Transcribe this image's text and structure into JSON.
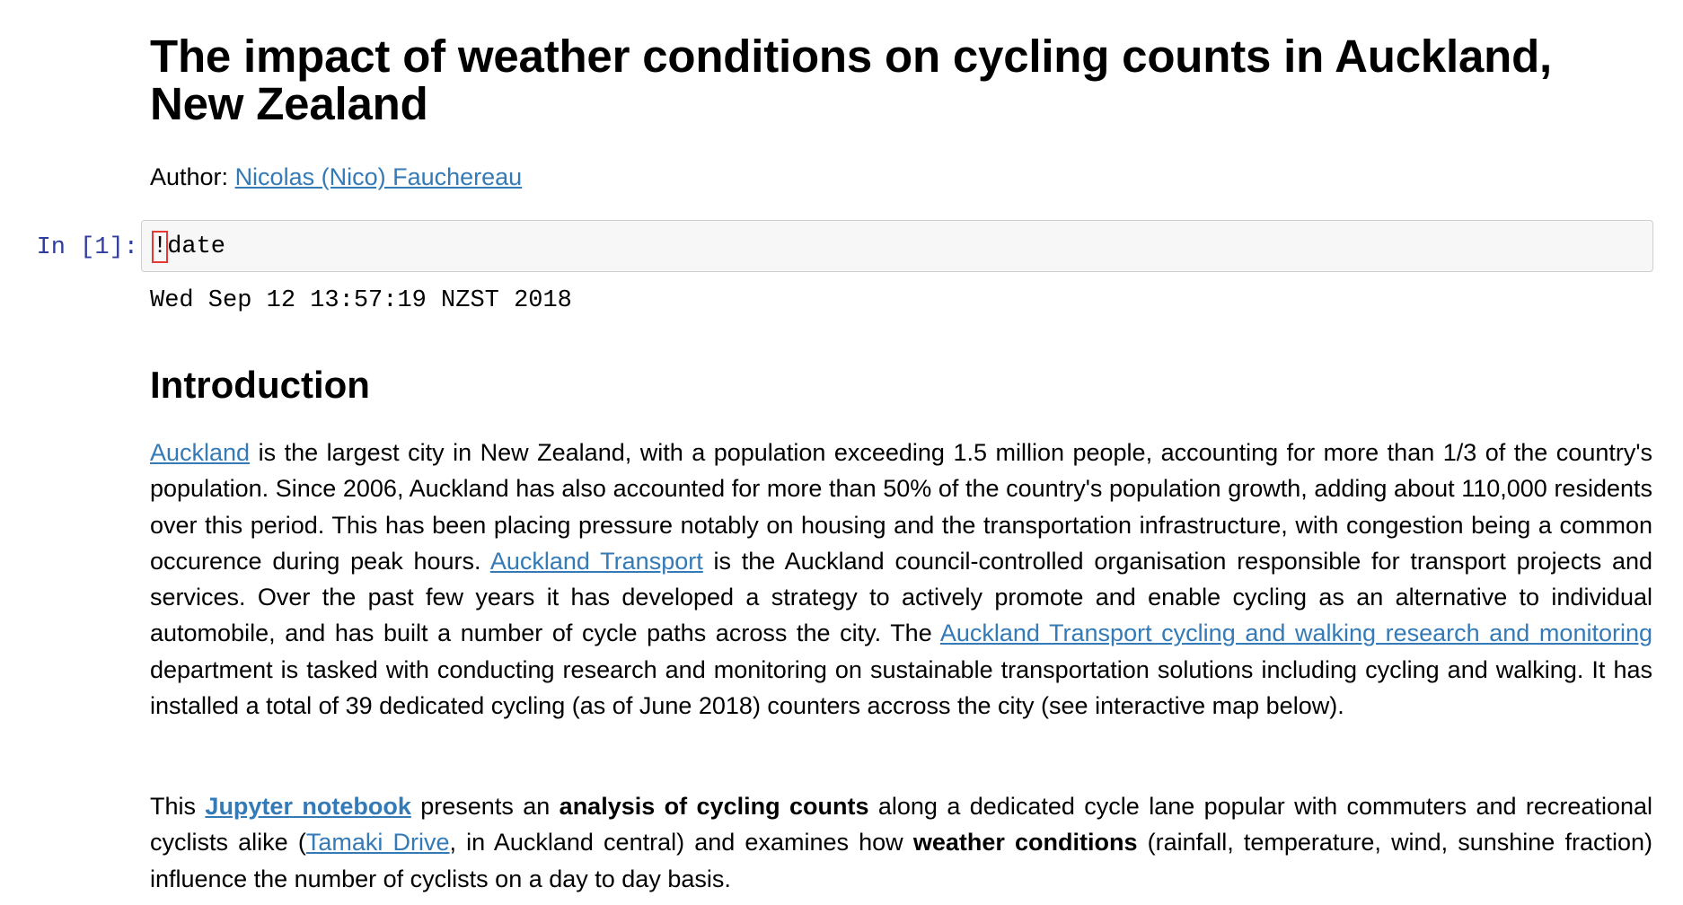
{
  "header": {
    "title": "The impact of weather conditions on cycling counts in Auckland, New Zealand",
    "author_label": "Author: ",
    "author_name": "Nicolas (Nico) Fauchereau"
  },
  "cell1": {
    "prompt": "In [1]:",
    "code_bang": "!",
    "code_rest": "date",
    "output": "Wed Sep 12 13:57:19 NZST 2018"
  },
  "intro": {
    "heading": "Introduction",
    "p1": {
      "link_auckland": "Auckland",
      "t1": " is the largest city in New Zealand, with a population exceeding 1.5 million people, accounting for more than 1/3 of the country's population. Since 2006, Auckland has also accounted for more than 50% of the country's population growth, adding about 110,000 residents over this period. This has been placing pressure notably on housing and the transportation infrastructure, with congestion being a common occurence during peak hours. ",
      "link_at": "Auckland Transport",
      "t2": " is the Auckland council-controlled organisation responsible for transport projects and services. Over the past few years it has developed a strategy to actively promote and enable cycling as an alternative to individual automobile, and has built a number of cycle paths across the city. The ",
      "link_research": "Auckland Transport cycling and walking research and monitoring",
      "t3": " department is tasked with conducting research and monitoring on sustainable transportation solutions including cycling and walking. It has installed a total of 39 dedicated cycling (as of June 2018) counters accross the city (see interactive map below)."
    },
    "p2": {
      "t1": "This ",
      "link_jupyter": "Jupyter notebook",
      "t2": " presents an ",
      "bold1": "analysis of cycling counts",
      "t3": " along a dedicated cycle lane popular with commuters and recreational cyclists alike (",
      "link_tamaki": "Tamaki Drive",
      "t4": ", in Auckland central) and examines how ",
      "bold2": "weather conditions",
      "t5": " (rainfall, temperature, wind, sunshine fraction) influence the number of cyclists on a day to day basis."
    }
  },
  "colors": {
    "link": "#337ab7",
    "prompt": "#303f9f",
    "cell_bg": "#f7f7f7",
    "cell_border": "#cfcfcf",
    "cursor_outline": "#e53935"
  }
}
